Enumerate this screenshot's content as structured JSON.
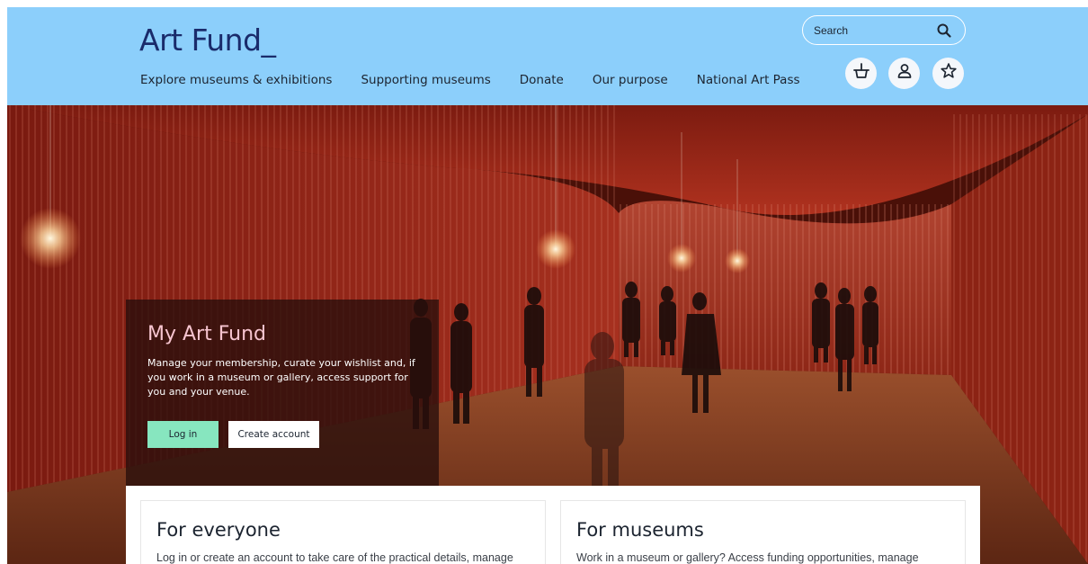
{
  "header": {
    "logo": "Art Fund_",
    "nav": [
      "Explore museums & exhibitions",
      "Supporting museums",
      "Donate",
      "Our purpose",
      "National Art Pass"
    ],
    "search": {
      "placeholder": "Search",
      "icon": "search-icon"
    },
    "icons": [
      "basket-icon",
      "user-icon",
      "star-icon"
    ],
    "bg_color": "#8ccffb"
  },
  "hero": {
    "panel": {
      "title": "My Art Fund",
      "text": "Manage your membership, curate your wishlist and, if you work in a museum or gallery, access support for you and your venue.",
      "login_label": "Log in",
      "create_label": "Create account"
    }
  },
  "cards": [
    {
      "title": "For everyone",
      "text": "Log in or create an account to take care of the practical details, manage"
    },
    {
      "title": "For museums",
      "text": "Work in a museum or gallery? Access funding opportunities, manage"
    }
  ]
}
